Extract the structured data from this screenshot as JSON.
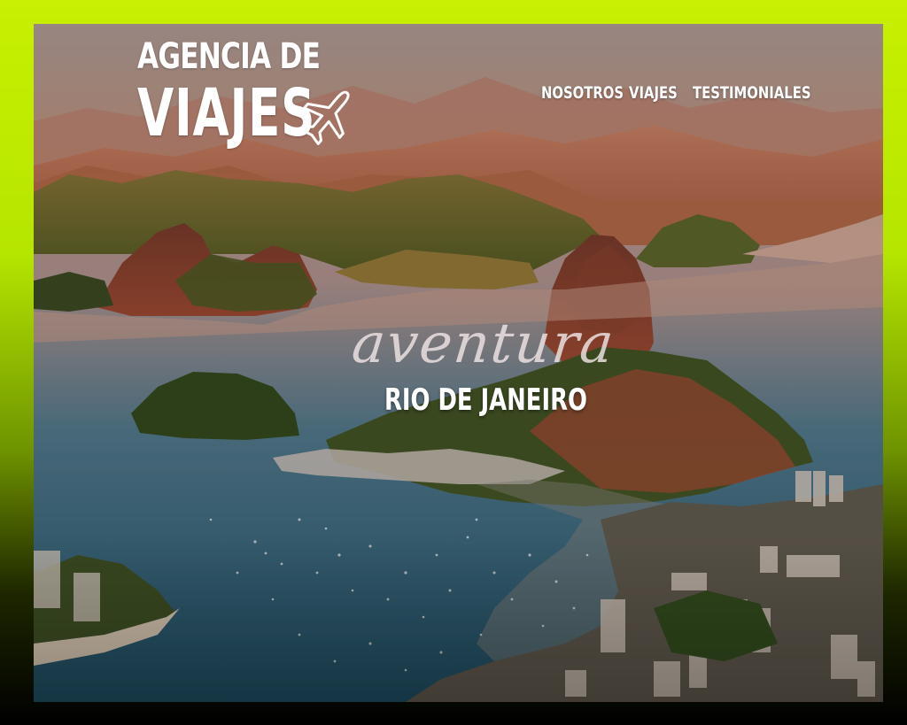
{
  "logo": {
    "line1": "AGENCIA DE",
    "line2": "VIAJES",
    "icon": "airplane-icon"
  },
  "nav": {
    "items": [
      {
        "label": "NOSOTROS"
      },
      {
        "label": "VIAJES"
      },
      {
        "label": "TESTIMONIALES"
      }
    ]
  },
  "hero": {
    "tagline": "aventura",
    "city": "RIO DE JANEIRO",
    "image": "rio-de-janeiro-aerial-photo"
  },
  "colors": {
    "frame_top": "#c8f000",
    "frame_bottom": "#000000",
    "text": "#ffffff"
  }
}
